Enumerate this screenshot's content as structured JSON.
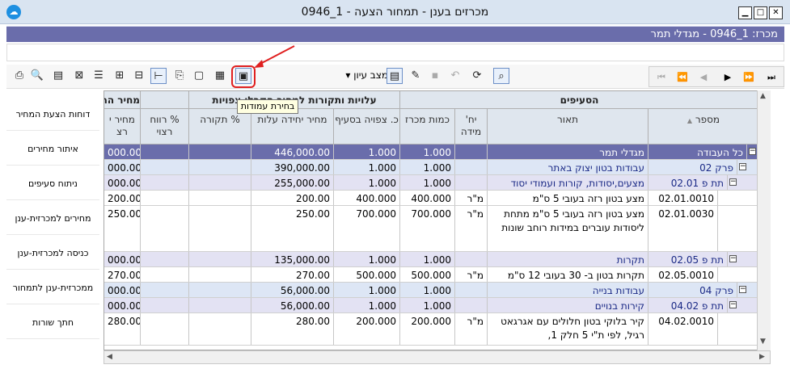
{
  "window": {
    "title": "מכרזים בענן - תמחור הצעה - 1_0946",
    "minimize": "▁",
    "maximize": "□",
    "close": "✕"
  },
  "infobar": {
    "text": "מכרז: 1_0946 - מגדלי תמר"
  },
  "toolbar": {
    "view_label": "מצב עיון",
    "tooltip": "בחירת עמודות"
  },
  "sidebar": {
    "items": [
      {
        "label": "דוחות הצעת המחיר"
      },
      {
        "label": "איתור מחירים"
      },
      {
        "label": "ניתוח סעיפים"
      },
      {
        "label": "מחירים למכרזית-ענן"
      },
      {
        "label": "כניסה למכרזית-ענן"
      },
      {
        "label": "ממכרזית-ענן לתמחור"
      },
      {
        "label": "חתך שורות"
      }
    ]
  },
  "grid": {
    "group_headers": {
      "items": "הסעיפים",
      "costs": "עלויות ותקורות למחיר הקבלן צפויות",
      "price": "מחיר הה"
    },
    "columns": {
      "number": "מספר",
      "description": "תאור",
      "unit": "יח' מידה",
      "qty": "כמות מכרז",
      "planned_qty": "כ. צפויה בסעיף",
      "unit_cost": "מחיר יחידה עלות",
      "overhead": "% תקורה",
      "profit": "% רווח רצוי",
      "price": "מחיר י רצ"
    },
    "rows": [
      {
        "number": "כל העבודה",
        "description": "מגדלי תמר",
        "unit": "",
        "qty": "1.000",
        "planned": "1.000",
        "unit_cost": "446,000.00",
        "price": "000.00"
      },
      {
        "number": "פרק 02",
        "description": "עבודות בטון יצוק באתר",
        "unit": "",
        "qty": "1.000",
        "planned": "1.000",
        "unit_cost": "390,000.00",
        "price": "000.00"
      },
      {
        "number": "תת פ 02.01",
        "description": "מצעים,יסודות, קורות ועמודי יסוד",
        "unit": "",
        "qty": "1.000",
        "planned": "1.000",
        "unit_cost": "255,000.00",
        "price": "000.00"
      },
      {
        "number": "02.01.0010",
        "description": "מצע בטון רזה בעובי 5 ס\"מ",
        "unit": "מ\"ר",
        "qty": "400.000",
        "planned": "400.000",
        "unit_cost": "200.00",
        "price": "200.00"
      },
      {
        "number": "02.01.0030",
        "description": "מצע בטון רזה בעובי 5 ס\"מ מתחת ליסודות עוברים במידות רוחב שונות",
        "unit": "מ\"ר",
        "qty": "700.000",
        "planned": "700.000",
        "unit_cost": "250.00",
        "price": "250.00"
      },
      {
        "number": "תת פ 02.05",
        "description": "תקרות",
        "unit": "",
        "qty": "1.000",
        "planned": "1.000",
        "unit_cost": "135,000.00",
        "price": "000.00"
      },
      {
        "number": "02.05.0010",
        "description": "תקרות בטון ב- 30 בעובי 12 ס\"מ",
        "unit": "מ\"ר",
        "qty": "500.000",
        "planned": "500.000",
        "unit_cost": "270.00",
        "price": "270.00"
      },
      {
        "number": "פרק 04",
        "description": "עבודות בנייה",
        "unit": "",
        "qty": "1.000",
        "planned": "1.000",
        "unit_cost": "56,000.00",
        "price": "000.00"
      },
      {
        "number": "תת פ 04.02",
        "description": "קירות בנויים",
        "unit": "",
        "qty": "1.000",
        "planned": "1.000",
        "unit_cost": "56,000.00",
        "price": "000.00"
      },
      {
        "number": "04.02.0010",
        "description": "קיר בלוקי בטון חלולים עם אגרגאט רגיל, לפי ת\"י 5 חלק 1,",
        "unit": "מ\"ר",
        "qty": "200.000",
        "planned": "200.000",
        "unit_cost": "280.00",
        "price": "280.00"
      }
    ]
  }
}
